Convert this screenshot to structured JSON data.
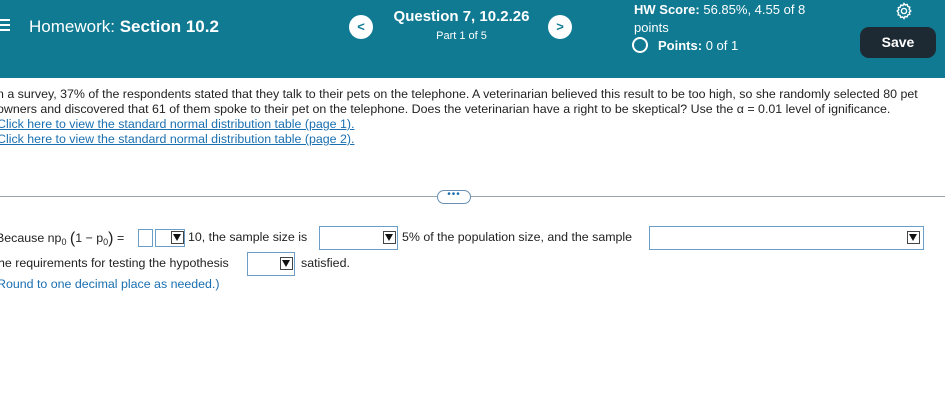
{
  "header": {
    "homework_label": "Homework:",
    "section": "Section 10.2",
    "question_title": "Question 7, 10.2.26",
    "part": "Part 1 of 5",
    "hw_score_label": "HW Score:",
    "hw_score_value": "56.85%, 4.55 of 8",
    "hw_score_unit": "points",
    "points_label": "Points:",
    "points_value": "0 of 1",
    "save_label": "Save",
    "prev_glyph": "<",
    "next_glyph": ">"
  },
  "question": {
    "text": "n a survey, 37% of the respondents stated that they talk to their pets on the telephone. A veterinarian believed this result to be too high, so she randomly selected 80 pet owners and discovered that 61 of them spoke to their pet on the telephone. Does the veterinarian have a right to be skeptical? Use the α = 0.01 level of ignificance.",
    "link1": "Click here to view the standard normal distribution table (page 1).",
    "link2": "Click here to view the standard normal distribution table (page 2).",
    "expander": "•••"
  },
  "answer": {
    "line1_prefix": "Because np",
    "line1_sub": "0",
    "line1_paren_open": "(",
    "line1_one_minus": "1 − p",
    "line1_paren_close": ")",
    "line1_equals": "=",
    "line1_after_drop": "10, the sample size is",
    "line1_mid": "5% of the population size, and the sample",
    "line2_prefix": "he requirements for testing the hypothesis",
    "line2_suffix": "satisfied.",
    "line3": "Round to one decimal place as needed.)"
  }
}
